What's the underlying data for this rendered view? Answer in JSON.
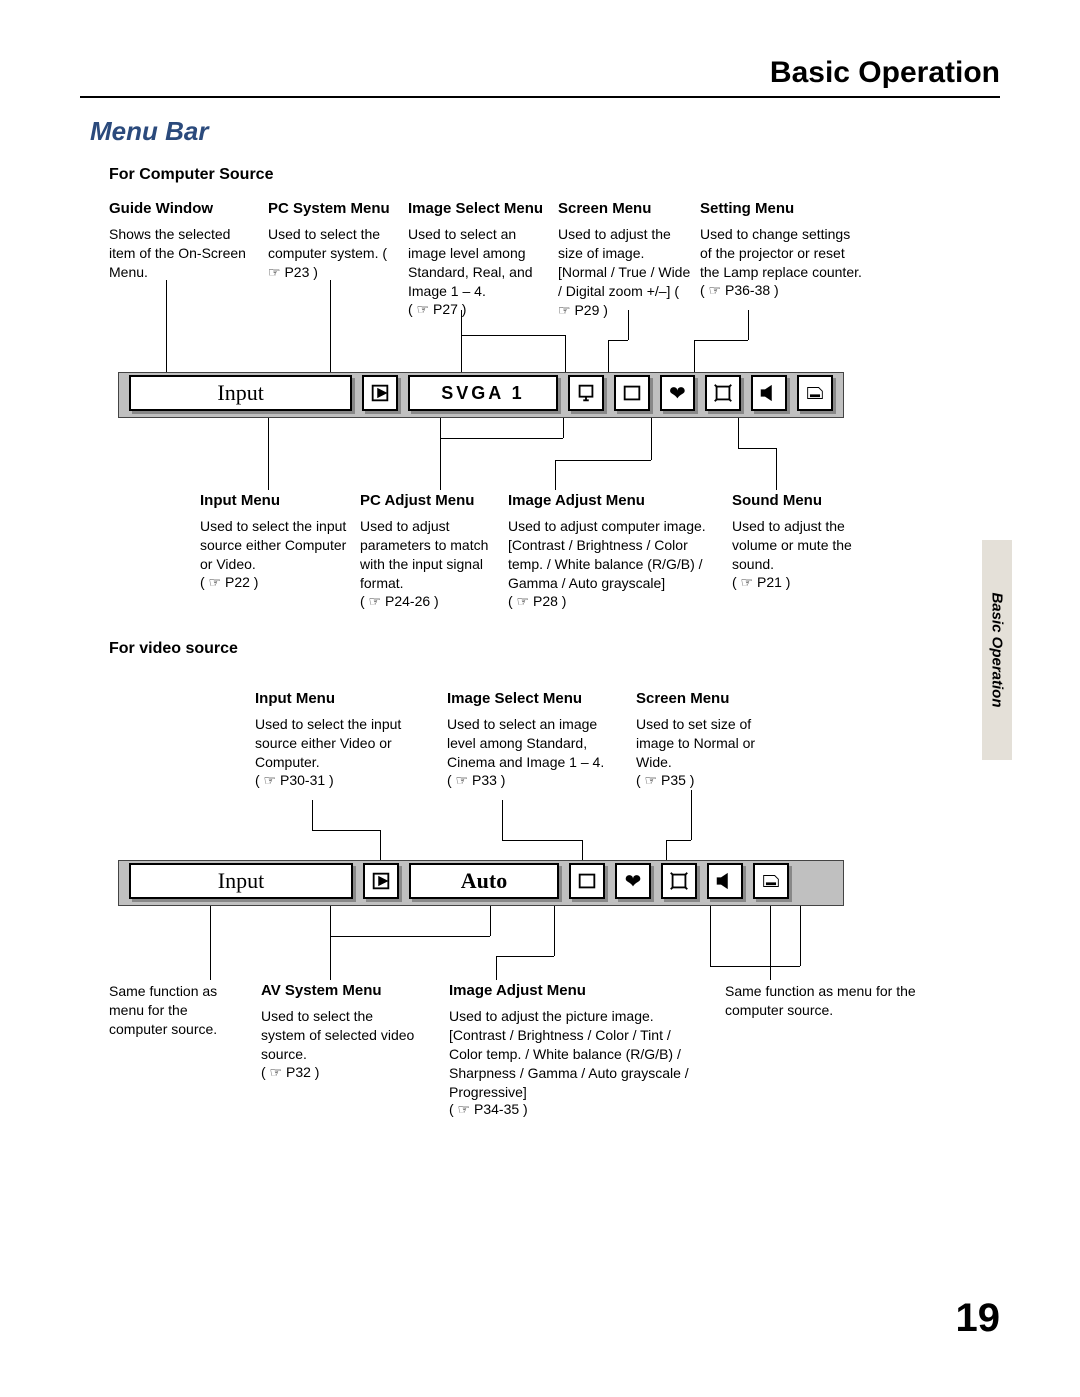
{
  "page": {
    "header": "Basic Operation",
    "sectionTitle": "Menu Bar",
    "sideTab": "Basic Operation",
    "number": "19"
  },
  "computer": {
    "heading": "For  Computer  Source",
    "top": {
      "guideWindow": {
        "title": "Guide Window",
        "desc": "Shows the selected item of the On-Screen Menu."
      },
      "pcSystem": {
        "title": "PC System Menu",
        "desc": "Used to select the computer system. ( ☞ P23 )"
      },
      "imageSelect": {
        "title": "Image Select Menu",
        "desc": "Used to select  an image level among Standard, Real, and Image 1 – 4.",
        "ref": "( ☞ P27 )"
      },
      "screen": {
        "title": "Screen Menu",
        "desc": "Used to adjust the size of image. [Normal / True / Wide / Digital zoom +/–] ( ☞ P29 )"
      },
      "setting": {
        "title": "Setting Menu",
        "desc": "Used to change settings of the projector or reset  the Lamp replace counter.",
        "ref": "( ☞ P36-38 )"
      }
    },
    "bottom": {
      "input": {
        "title": "Input Menu",
        "desc": "Used to select the input source either Computer or Video.",
        "ref": "( ☞ P22 )"
      },
      "pcAdjust": {
        "title": "PC Adjust Menu",
        "desc": "Used to adjust parameters to match with the input signal format.",
        "ref": "( ☞ P24-26 )"
      },
      "imageAdjust": {
        "title": "Image Adjust Menu",
        "desc": "Used to adjust computer image. [Contrast / Brightness / Color temp. /  White balance (R/G/B)  / Gamma / Auto grayscale]",
        "ref": "( ☞ P28 )"
      },
      "sound": {
        "title": "Sound Menu",
        "desc": "Used to adjust the volume or mute the sound.",
        "ref": "( ☞ P21 )"
      }
    },
    "bar": {
      "window": "Input",
      "mode": "SVGA 1"
    }
  },
  "video": {
    "heading": "For video source",
    "top": {
      "input": {
        "title": "Input Menu",
        "desc": "Used to select the input source either Video or Computer.",
        "ref": "( ☞ P30-31 )"
      },
      "imageSelect": {
        "title": "Image Select Menu",
        "desc": "Used to select an image level among Standard, Cinema and Image 1 – 4.",
        "ref": "( ☞ P33 )"
      },
      "screen": {
        "title": "Screen Menu",
        "desc": "Used to set size of image to Normal or Wide.",
        "ref": "( ☞ P35 )"
      }
    },
    "bottom": {
      "sameLeft": {
        "desc": "Same function as menu for the computer source."
      },
      "avSystem": {
        "title": "AV System Menu",
        "desc": "Used to select the system of selected video source.",
        "ref": "( ☞ P32 )"
      },
      "imageAdjust": {
        "title": "Image Adjust Menu",
        "desc": "Used to adjust the picture image. [Contrast / Brightness / Color / Tint / Color temp. / White balance (R/G/B) / Sharpness /  Gamma / Auto grayscale / Progressive]",
        "ref": "( ☞ P34-35 )"
      },
      "sameRight": {
        "desc": "Same function as menu for the computer source."
      }
    },
    "bar": {
      "window": "Input",
      "mode": "Auto"
    }
  }
}
